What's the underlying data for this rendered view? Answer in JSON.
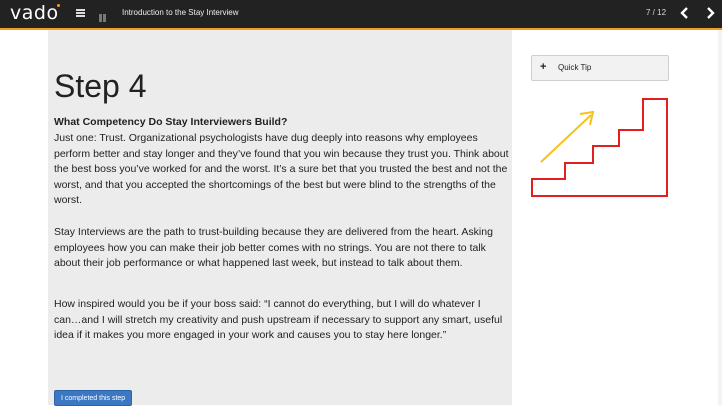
{
  "header": {
    "logo_text": "vad",
    "logo_o": "o",
    "course_title": "Introduction to the Stay Interview",
    "page_count": "7 / 12",
    "prev_icon": "‹",
    "next_icon": "›"
  },
  "main": {
    "step_title": "Step 4",
    "sub_heading": "What Competency Do Stay Interviewers Build?",
    "paragraphs": [
      "Just one: Trust. Organizational psychologists have dug deeply into reasons why employees perform better and stay longer and they’ve found that you win because they trust you. Think about the best boss you’ve worked for and the worst. It’s a sure bet that you trusted the best and not the worst, and that you accepted the shortcomings of the best but were blind to the strengths of the worst.",
      "Stay Interviews are the path to trust-building because they are delivered from the heart. Asking employees how you can make their job better comes with no strings. You are not there to talk about their job performance or what happened last week, but instead to talk about them.",
      "How inspired would you be if your boss said: “I cannot do everything, but I will do whatever I can…and I will stretch my creativity and push upstream if necessary to support any smart, useful idea if it makes you more engaged in your work and causes you to stay here longer.”"
    ],
    "complete_button": "I completed this step"
  },
  "sidebar": {
    "tip_plus": "+",
    "tip_label": "Quick Tip",
    "stairs_color": "#e02020",
    "arrow_color": "#f5c21a"
  }
}
